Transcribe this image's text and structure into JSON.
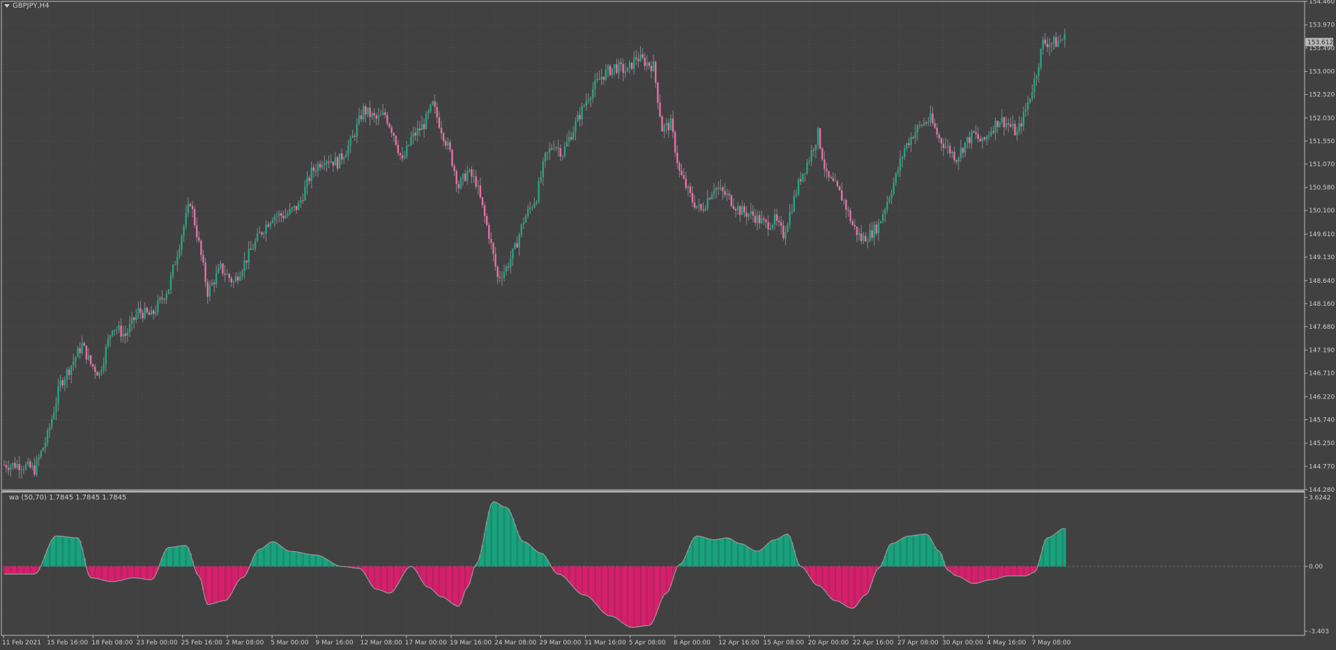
{
  "window": {
    "symbol_label": "GBPJPY,H4",
    "dropdown_icon": "triangle-down-icon"
  },
  "indicator": {
    "label": "wa (50,70) 1.7845 1.7845 1.7845"
  },
  "price_tag": "153.612",
  "colors": {
    "background": "#414141",
    "grid": "#4c4c4c",
    "frame": "#bdbdbd",
    "bull": "#1fa882",
    "bear": "#f06ea5",
    "hist_pos": "#16a37e",
    "hist_neg": "#d81e6c",
    "hist_outline": "#9a9a9a",
    "text": "#cfcfcf"
  },
  "chart_data": [
    {
      "type": "candlestick",
      "title": "GBPJPY,H4",
      "ylim": [
        144.28,
        154.46
      ],
      "y_ticks": [
        "154.460",
        "153.970",
        "153.490",
        "153.000",
        "152.520",
        "152.030",
        "151.550",
        "151.070",
        "150.580",
        "150.100",
        "149.610",
        "149.130",
        "148.640",
        "148.160",
        "147.680",
        "147.190",
        "146.710",
        "146.220",
        "145.740",
        "145.250",
        "144.770",
        "144.280"
      ],
      "last_price": 153.612,
      "grid": true,
      "close_path": [
        [
          0,
          144.8
        ],
        [
          8,
          144.8
        ],
        [
          14,
          144.7
        ],
        [
          20,
          145.4
        ],
        [
          26,
          146.5
        ],
        [
          30,
          146.8
        ],
        [
          36,
          147.3
        ],
        [
          40,
          146.9
        ],
        [
          44,
          146.7
        ],
        [
          50,
          147.7
        ],
        [
          56,
          147.5
        ],
        [
          62,
          148.0
        ],
        [
          68,
          147.9
        ],
        [
          76,
          148.5
        ],
        [
          82,
          149.6
        ],
        [
          86,
          150.3
        ],
        [
          90,
          149.4
        ],
        [
          94,
          148.4
        ],
        [
          100,
          148.9
        ],
        [
          106,
          148.6
        ],
        [
          112,
          149.1
        ],
        [
          118,
          149.6
        ],
        [
          124,
          150.0
        ],
        [
          130,
          150.0
        ],
        [
          136,
          150.2
        ],
        [
          142,
          150.9
        ],
        [
          148,
          151.2
        ],
        [
          154,
          151.1
        ],
        [
          160,
          151.5
        ],
        [
          166,
          152.2
        ],
        [
          172,
          152.0
        ],
        [
          176,
          152.1
        ],
        [
          180,
          151.7
        ],
        [
          184,
          151.1
        ],
        [
          188,
          151.6
        ],
        [
          194,
          151.9
        ],
        [
          198,
          152.3
        ],
        [
          202,
          151.8
        ],
        [
          206,
          151.3
        ],
        [
          210,
          150.6
        ],
        [
          214,
          150.9
        ],
        [
          218,
          150.7
        ],
        [
          224,
          149.6
        ],
        [
          228,
          148.7
        ],
        [
          232,
          148.9
        ],
        [
          236,
          149.3
        ],
        [
          240,
          149.9
        ],
        [
          246,
          150.4
        ],
        [
          250,
          151.2
        ],
        [
          254,
          151.5
        ],
        [
          258,
          151.3
        ],
        [
          262,
          151.7
        ],
        [
          266,
          152.1
        ],
        [
          270,
          152.5
        ],
        [
          276,
          152.9
        ],
        [
          282,
          153.1
        ],
        [
          288,
          153.0
        ],
        [
          292,
          153.3
        ],
        [
          296,
          153.2
        ],
        [
          300,
          153.1
        ],
        [
          304,
          151.8
        ],
        [
          308,
          151.9
        ],
        [
          312,
          150.9
        ],
        [
          318,
          150.3
        ],
        [
          322,
          150.1
        ],
        [
          328,
          150.6
        ],
        [
          334,
          150.4
        ],
        [
          340,
          150.1
        ],
        [
          346,
          150.0
        ],
        [
          352,
          149.8
        ],
        [
          356,
          149.9
        ],
        [
          360,
          149.6
        ],
        [
          364,
          150.2
        ],
        [
          368,
          150.8
        ],
        [
          372,
          151.2
        ],
        [
          376,
          151.7
        ],
        [
          380,
          150.8
        ],
        [
          384,
          150.6
        ],
        [
          388,
          150.3
        ],
        [
          392,
          149.8
        ],
        [
          396,
          149.5
        ],
        [
          400,
          149.6
        ],
        [
          404,
          149.8
        ],
        [
          408,
          150.3
        ],
        [
          412,
          150.8
        ],
        [
          416,
          151.4
        ],
        [
          420,
          151.7
        ],
        [
          424,
          151.9
        ],
        [
          428,
          152.0
        ],
        [
          432,
          151.6
        ],
        [
          436,
          151.4
        ],
        [
          440,
          151.2
        ],
        [
          444,
          151.5
        ],
        [
          448,
          151.7
        ],
        [
          452,
          151.5
        ],
        [
          456,
          151.8
        ],
        [
          460,
          152.0
        ],
        [
          464,
          151.9
        ],
        [
          468,
          151.7
        ],
        [
          472,
          152.2
        ],
        [
          476,
          152.8
        ],
        [
          480,
          153.6
        ],
        [
          486,
          153.6
        ],
        [
          490,
          153.7
        ]
      ],
      "candle_count": 491,
      "seed": 7
    },
    {
      "type": "histogram",
      "name": "wa (50,70)",
      "values_shown": [
        1.7845,
        1.7845,
        1.7845
      ],
      "ylim": [
        -3.403,
        3.6242
      ],
      "y_ticks": [
        "3.6242",
        "0.00",
        "-3.403"
      ],
      "zero_line": true,
      "curve": [
        [
          0,
          -0.4
        ],
        [
          14,
          -0.4
        ],
        [
          24,
          1.6
        ],
        [
          34,
          1.5
        ],
        [
          40,
          -0.6
        ],
        [
          50,
          -0.8
        ],
        [
          60,
          -0.6
        ],
        [
          68,
          -0.7
        ],
        [
          76,
          1.0
        ],
        [
          84,
          1.1
        ],
        [
          90,
          -0.5
        ],
        [
          94,
          -2.0
        ],
        [
          102,
          -1.8
        ],
        [
          110,
          -0.6
        ],
        [
          118,
          0.9
        ],
        [
          124,
          1.3
        ],
        [
          132,
          0.8
        ],
        [
          144,
          0.6
        ],
        [
          156,
          0.0
        ],
        [
          164,
          -0.1
        ],
        [
          172,
          -1.2
        ],
        [
          178,
          -1.4
        ],
        [
          188,
          0.0
        ],
        [
          196,
          -1.1
        ],
        [
          202,
          -1.6
        ],
        [
          210,
          -2.1
        ],
        [
          214,
          -1.1
        ],
        [
          218,
          0.1
        ],
        [
          226,
          3.4
        ],
        [
          232,
          3.1
        ],
        [
          240,
          1.3
        ],
        [
          248,
          0.7
        ],
        [
          256,
          -0.4
        ],
        [
          268,
          -1.5
        ],
        [
          280,
          -2.6
        ],
        [
          290,
          -3.2
        ],
        [
          298,
          -3.1
        ],
        [
          306,
          -1.4
        ],
        [
          312,
          0.1
        ],
        [
          320,
          1.6
        ],
        [
          328,
          1.4
        ],
        [
          334,
          1.5
        ],
        [
          340,
          1.2
        ],
        [
          348,
          0.8
        ],
        [
          356,
          1.4
        ],
        [
          362,
          1.7
        ],
        [
          368,
          0.0
        ],
        [
          376,
          -1.0
        ],
        [
          384,
          -1.8
        ],
        [
          392,
          -2.2
        ],
        [
          398,
          -1.5
        ],
        [
          404,
          -0.1
        ],
        [
          410,
          1.2
        ],
        [
          418,
          1.6
        ],
        [
          426,
          1.7
        ],
        [
          432,
          0.8
        ],
        [
          436,
          -0.2
        ],
        [
          440,
          -0.5
        ],
        [
          448,
          -0.9
        ],
        [
          456,
          -0.7
        ],
        [
          464,
          -0.5
        ],
        [
          472,
          -0.5
        ],
        [
          476,
          -0.3
        ],
        [
          482,
          1.5
        ],
        [
          490,
          2.0
        ]
      ]
    }
  ],
  "x_axis": {
    "labels": [
      "11 Feb 2021",
      "15 Feb 16:00",
      "18 Feb 08:00",
      "23 Feb 00:00",
      "25 Feb 16:00",
      "2 Mar 08:00",
      "5 Mar 00:00",
      "9 Mar 16:00",
      "12 Mar 08:00",
      "17 Mar 00:00",
      "19 Mar 16:00",
      "24 Mar 08:00",
      "29 Mar 00:00",
      "31 Mar 16:00",
      "5 Apr 08:00",
      "8 Apr 00:00",
      "12 Apr 16:00",
      "15 Apr 08:00",
      "20 Apr 00:00",
      "22 Apr 16:00",
      "27 Apr 08:00",
      "30 Apr 00:00",
      "4 May 16:00",
      "7 May 08:00"
    ]
  }
}
